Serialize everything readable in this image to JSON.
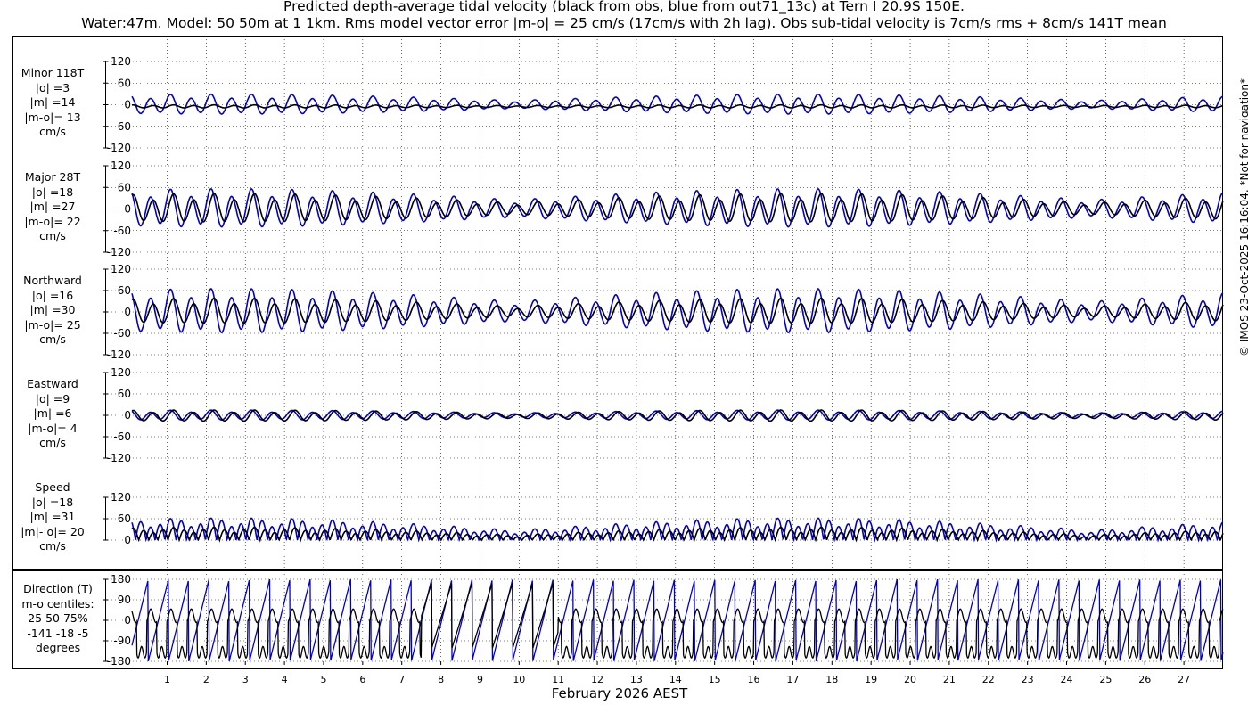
{
  "header": {
    "title_line1": "Predicted depth-average tidal velocity (black from obs, blue from out71_13c) at Tern I 20.9S 150E.",
    "title_line2": "Water:47m. Model: 50 50m at 1 1km. Rms model vector error |m-o| = 25 cm/s (17cm/s with 2h lag). Obs sub-tidal velocity is 7cm/s rms + 8cm/s 141T mean"
  },
  "copyright": "© IMOS 23-Oct-2025 16:16:04. *Not for navigation*",
  "colors": {
    "obs": "#000000",
    "model": "#0000cc",
    "grid": "#000000"
  },
  "chart_data": {
    "type": "line",
    "xlabel": "February 2026 AEST",
    "x_ticks": [
      "1",
      "2",
      "3",
      "4",
      "5",
      "6",
      "7",
      "8",
      "9",
      "10",
      "11",
      "12",
      "13",
      "14",
      "15",
      "16",
      "17",
      "18",
      "19",
      "20",
      "21",
      "22",
      "23",
      "24",
      "25",
      "26",
      "27"
    ],
    "x_range_days": [
      0.1,
      28.0
    ],
    "grid": true,
    "series_legend": [
      "black from obs",
      "blue from out71_13c"
    ],
    "panels": [
      {
        "key": "minor",
        "label_lines": [
          "Minor 118T",
          "|o| =3",
          "|m| =14",
          "|m-o|= 13",
          "cm/s"
        ],
        "ylim": [
          -120,
          120
        ],
        "yticks": [
          "120",
          "60",
          "0",
          "-60",
          "-120"
        ],
        "obs": {
          "amp": 4,
          "spring_mod": 0.4,
          "offset": -5
        },
        "model": {
          "amp": 26,
          "spring_mod": 0.6,
          "offset": 0
        }
      },
      {
        "key": "major",
        "label_lines": [
          "Major 28T",
          "|o| =18",
          "|m| =27",
          "|m-o|= 22",
          "cm/s"
        ],
        "ylim": [
          -120,
          120
        ],
        "yticks": [
          "120",
          "60",
          "0",
          "-60",
          "-120"
        ],
        "obs": {
          "amp": 38,
          "spring_mod": 0.6,
          "offset": 0
        },
        "model": {
          "amp": 50,
          "spring_mod": 0.55,
          "offset": 0
        }
      },
      {
        "key": "northward",
        "label_lines": [
          "Northward",
          "|o| =16",
          "|m| =30",
          "|m-o|= 25",
          "cm/s"
        ],
        "ylim": [
          -120,
          120
        ],
        "yticks": [
          "120",
          "60",
          "0",
          "-60",
          "-120"
        ],
        "obs": {
          "amp": 34,
          "spring_mod": 0.6,
          "offset": 0
        },
        "model": {
          "amp": 58,
          "spring_mod": 0.55,
          "offset": 0
        }
      },
      {
        "key": "eastward",
        "label_lines": [
          "Eastward",
          "|o| =9",
          "|m| =6",
          "|m-o|= 4",
          "cm/s"
        ],
        "ylim": [
          -120,
          120
        ],
        "yticks": [
          "120",
          "60",
          "0",
          "-60",
          "-120"
        ],
        "obs": {
          "amp": 15,
          "spring_mod": 0.55,
          "offset": -2
        },
        "model": {
          "amp": 13,
          "spring_mod": 0.55,
          "offset": 0
        }
      },
      {
        "key": "speed",
        "label_lines": [
          "Speed",
          "|o| =18",
          "|m| =31",
          "|m|-|o|= 20",
          "cm/s"
        ],
        "ylim": [
          0,
          120
        ],
        "yticks": [
          "120",
          "60",
          "0"
        ],
        "obs": {
          "amp": 32,
          "spring_mod": 0.6,
          "offset": 0
        },
        "model": {
          "amp": 55,
          "spring_mod": 0.55,
          "offset": 0
        }
      },
      {
        "key": "direction",
        "label_lines": [
          "Direction (T)",
          "m-o centiles:",
          "25  50  75%",
          "-141  -18   -5",
          "degrees"
        ],
        "ylim": [
          -180,
          180
        ],
        "yticks": [
          "180",
          "90",
          "0",
          "-90",
          "-180"
        ]
      }
    ]
  }
}
